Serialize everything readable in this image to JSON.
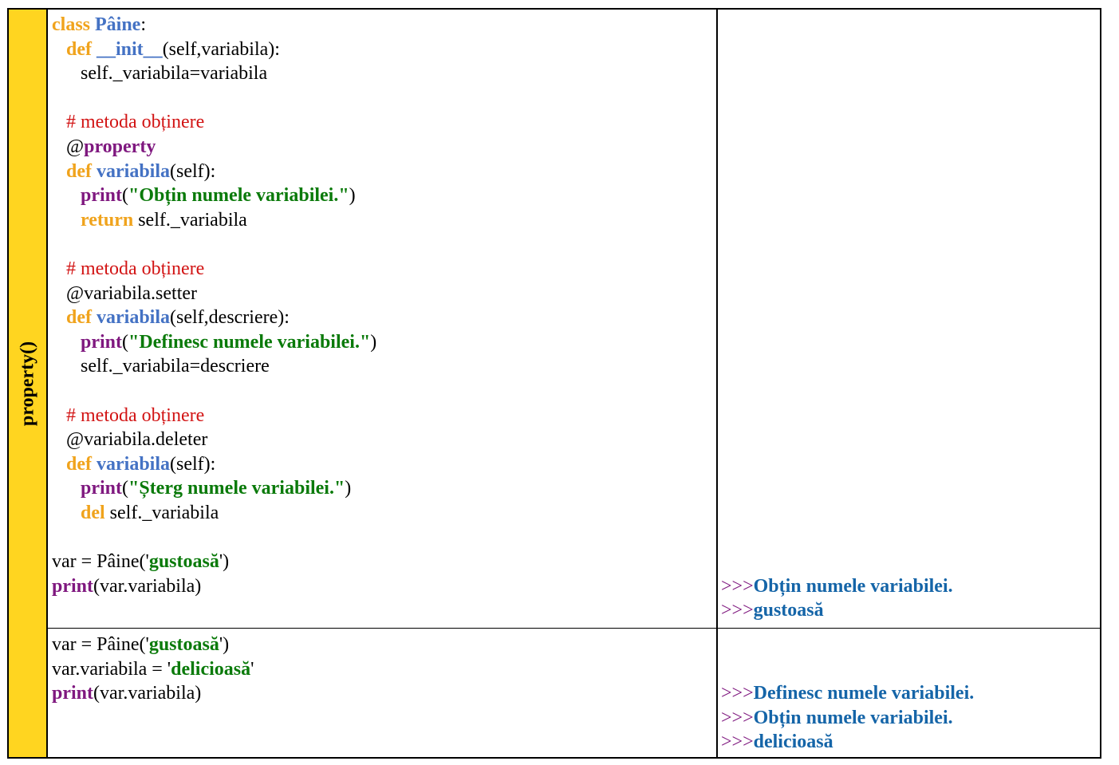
{
  "sidebar": {
    "label": "property()"
  },
  "rows": [
    {
      "code": [
        [
          {
            "t": "class ",
            "c": "kw"
          },
          {
            "t": "Pâine",
            "c": "fn"
          },
          {
            "t": ":",
            "c": ""
          }
        ],
        [
          {
            "t": "   ",
            "c": ""
          },
          {
            "t": "def ",
            "c": "kw"
          },
          {
            "t": "__init__",
            "c": "fn"
          },
          {
            "t": "(self,variabila):",
            "c": ""
          }
        ],
        [
          {
            "t": "      self._variabila=variabila",
            "c": ""
          }
        ],
        [],
        [
          {
            "t": "   ",
            "c": ""
          },
          {
            "t": "# metoda obținere",
            "c": "cm"
          }
        ],
        [
          {
            "t": "   @",
            "c": ""
          },
          {
            "t": "property",
            "c": "bi"
          }
        ],
        [
          {
            "t": "   ",
            "c": ""
          },
          {
            "t": "def ",
            "c": "kw"
          },
          {
            "t": "variabila",
            "c": "fn"
          },
          {
            "t": "(self):",
            "c": ""
          }
        ],
        [
          {
            "t": "      ",
            "c": ""
          },
          {
            "t": "print",
            "c": "bi"
          },
          {
            "t": "(",
            "c": ""
          },
          {
            "t": "\"Obțin numele variabilei.\"",
            "c": "str"
          },
          {
            "t": ")",
            "c": ""
          }
        ],
        [
          {
            "t": "      ",
            "c": ""
          },
          {
            "t": "return ",
            "c": "kw"
          },
          {
            "t": "self._variabila",
            "c": ""
          }
        ],
        [],
        [
          {
            "t": "   ",
            "c": ""
          },
          {
            "t": "# metoda obținere",
            "c": "cm"
          }
        ],
        [
          {
            "t": "   @variabila.setter",
            "c": ""
          }
        ],
        [
          {
            "t": "   ",
            "c": ""
          },
          {
            "t": "def ",
            "c": "kw"
          },
          {
            "t": "variabila",
            "c": "fn"
          },
          {
            "t": "(self,descriere):",
            "c": ""
          }
        ],
        [
          {
            "t": "      ",
            "c": ""
          },
          {
            "t": "print",
            "c": "bi"
          },
          {
            "t": "(",
            "c": ""
          },
          {
            "t": "\"Definesc numele variabilei.\"",
            "c": "str"
          },
          {
            "t": ")",
            "c": ""
          }
        ],
        [
          {
            "t": "      self._variabila=descriere",
            "c": ""
          }
        ],
        [],
        [
          {
            "t": "   ",
            "c": ""
          },
          {
            "t": "# metoda obținere",
            "c": "cm"
          }
        ],
        [
          {
            "t": "   @variabila.deleter",
            "c": ""
          }
        ],
        [
          {
            "t": "   ",
            "c": ""
          },
          {
            "t": "def ",
            "c": "kw"
          },
          {
            "t": "variabila",
            "c": "fn"
          },
          {
            "t": "(self):",
            "c": ""
          }
        ],
        [
          {
            "t": "      ",
            "c": ""
          },
          {
            "t": "print",
            "c": "bi"
          },
          {
            "t": "(",
            "c": ""
          },
          {
            "t": "\"Șterg numele variabilei.\"",
            "c": "str"
          },
          {
            "t": ")",
            "c": ""
          }
        ],
        [
          {
            "t": "      ",
            "c": ""
          },
          {
            "t": "del ",
            "c": "kw"
          },
          {
            "t": "self._variabila",
            "c": ""
          }
        ],
        [],
        [
          {
            "t": "var = Pâine('",
            "c": ""
          },
          {
            "t": "gustoasă",
            "c": "str"
          },
          {
            "t": "')",
            "c": ""
          }
        ],
        [
          {
            "t": "print",
            "c": "bi"
          },
          {
            "t": "(var.variabila)",
            "c": ""
          }
        ]
      ],
      "output_blank_lines": 23,
      "output": [
        "Obțin numele variabilei.",
        "gustoasă"
      ]
    },
    {
      "code": [
        [
          {
            "t": "var = Pâine('",
            "c": ""
          },
          {
            "t": "gustoasă",
            "c": "str"
          },
          {
            "t": "')",
            "c": ""
          }
        ],
        [
          {
            "t": "var.variabila = '",
            "c": ""
          },
          {
            "t": "delicioasă",
            "c": "str"
          },
          {
            "t": "'",
            "c": ""
          }
        ],
        [
          {
            "t": "print",
            "c": "bi"
          },
          {
            "t": "(var.variabila)",
            "c": ""
          }
        ]
      ],
      "output_blank_lines": 2,
      "output": [
        "Definesc numele variabilei.",
        "Obțin numele variabilei.",
        "delicioasă"
      ]
    }
  ],
  "prompt": ">>>",
  "colors": {
    "sidebar_bg": "#ffd520",
    "keyword": "#f0a31c",
    "function_name": "#4472c4",
    "builtin": "#7f187f",
    "string": "#0a7a0a",
    "comment": "#d21414",
    "prompt": "#7f187f",
    "output": "#1565a8"
  }
}
